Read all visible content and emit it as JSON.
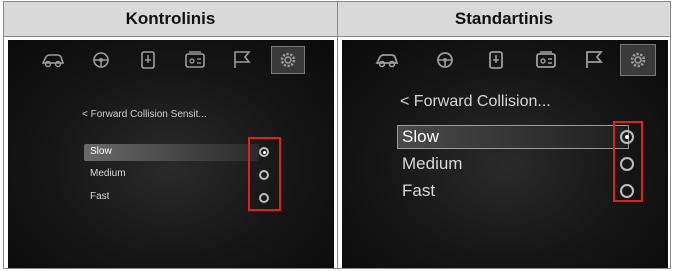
{
  "columns": [
    {
      "header": "Kontrolinis",
      "screen": {
        "icons": [
          "car-icon",
          "steering-icon",
          "seat-icon",
          "radio-icon",
          "flag-icon",
          "gear-icon"
        ],
        "selected_icon": "gear-icon",
        "breadcrumb": "< Forward Collision Sensit...",
        "options": [
          {
            "label": "Slow",
            "selected": true
          },
          {
            "label": "Medium",
            "selected": false
          },
          {
            "label": "Fast",
            "selected": false
          }
        ]
      }
    },
    {
      "header": "Standartinis",
      "screen": {
        "icons": [
          "car-icon",
          "steering-icon",
          "seat-icon",
          "radio-icon",
          "flag-icon",
          "gear-icon"
        ],
        "selected_icon": "gear-icon",
        "breadcrumb": "< Forward Collision...",
        "options": [
          {
            "label": "Slow",
            "selected": true
          },
          {
            "label": "Medium",
            "selected": false
          },
          {
            "label": "Fast",
            "selected": false
          }
        ]
      }
    }
  ],
  "colors": {
    "header_bg": "#d9d9d9",
    "highlight_box": "#e02020",
    "screen_bg": "#151515"
  }
}
